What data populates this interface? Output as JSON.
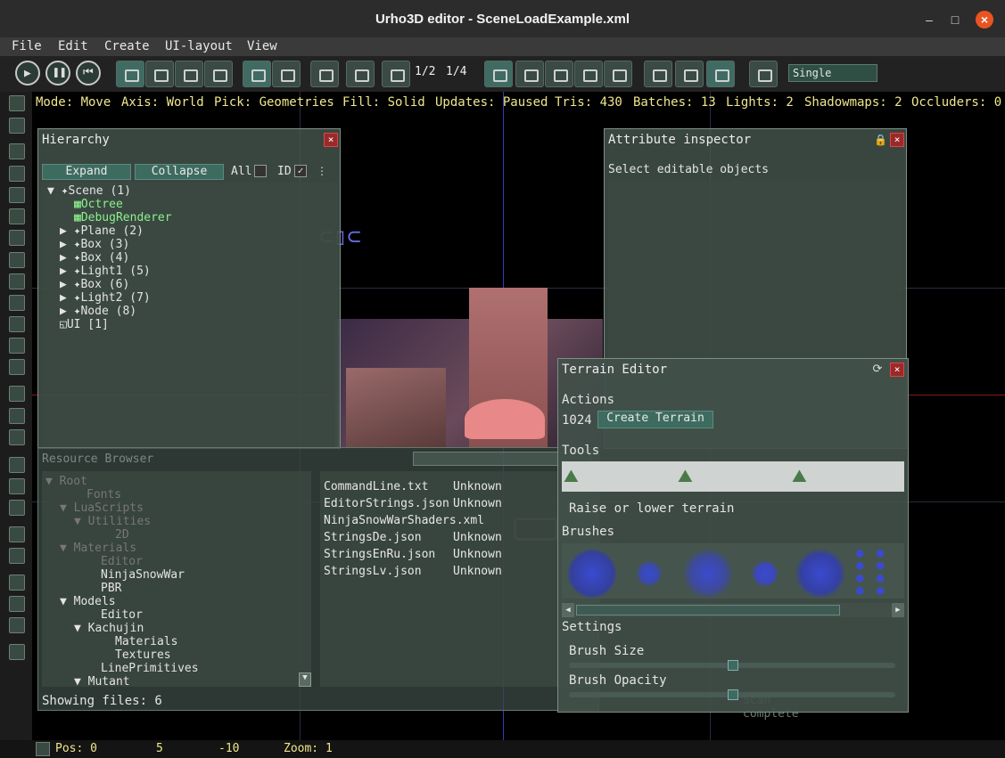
{
  "window": {
    "title": "Urho3D editor - SceneLoadExample.xml"
  },
  "menu": [
    "File",
    "Edit",
    "Create",
    "UI-layout",
    "View"
  ],
  "toolbar": {
    "half": "1/2",
    "quarter": "1/4",
    "pick_mode": "Single"
  },
  "status": {
    "mode": "Mode: Move",
    "axis": "Axis: World",
    "pick": "Pick: Geometries",
    "fill": "Fill: Solid",
    "updates": "Updates: Paused",
    "tris": "Tris: 430",
    "batches": "Batches: 13",
    "lights": "Lights: 2",
    "shadowmaps": "Shadowmaps: 2",
    "occluders": "Occluders: 0"
  },
  "hierarchy": {
    "title": "Hierarchy",
    "expand": "Expand",
    "collapse": "Collapse",
    "all": "All",
    "id": "ID",
    "items": [
      "Scene (1)",
      "Octree",
      "DebugRenderer",
      "Plane (2)",
      "Box (3)",
      "Box (4)",
      "Light1 (5)",
      "Box (6)",
      "Light2 (7)",
      "Node (8)",
      "UI [1]"
    ]
  },
  "inspector": {
    "title": "Attribute inspector",
    "hint": "Select editable objects"
  },
  "resources": {
    "title": "Resource Browser",
    "tree": [
      "Root",
      "Fonts",
      "LuaScripts",
      "Utilities",
      "2D",
      "Materials",
      "Editor",
      "NinjaSnowWar",
      "PBR",
      "Models",
      "Editor",
      "Kachujin",
      "Materials",
      "Textures",
      "LinePrimitives",
      "Mutant"
    ],
    "files": [
      {
        "name": "CommandLine.txt",
        "type": "Unknown"
      },
      {
        "name": "EditorStrings.json",
        "type": "Unknown"
      },
      {
        "name": "NinjaSnowWarShaders.xml",
        "type": ""
      },
      {
        "name": "StringsDe.json",
        "type": "Unknown"
      },
      {
        "name": "StringsEnRu.json",
        "type": "Unknown"
      },
      {
        "name": "StringsLv.json",
        "type": "Unknown"
      }
    ],
    "showing": "Showing files: 6",
    "scan": "Scan complete"
  },
  "terrain": {
    "title": "Terrain Editor",
    "actions": "Actions",
    "size": "1024",
    "create": "Create Terrain",
    "tools": "Tools",
    "tool_desc": "Raise or lower terrain",
    "brushes": "Brushes",
    "settings": "Settings",
    "brush_size": "Brush Size",
    "brush_opacity": "Brush Opacity"
  },
  "bottom": {
    "pos": "Pos: 0",
    "y": "5",
    "z": "-10",
    "zoom": "Zoom: 1"
  }
}
